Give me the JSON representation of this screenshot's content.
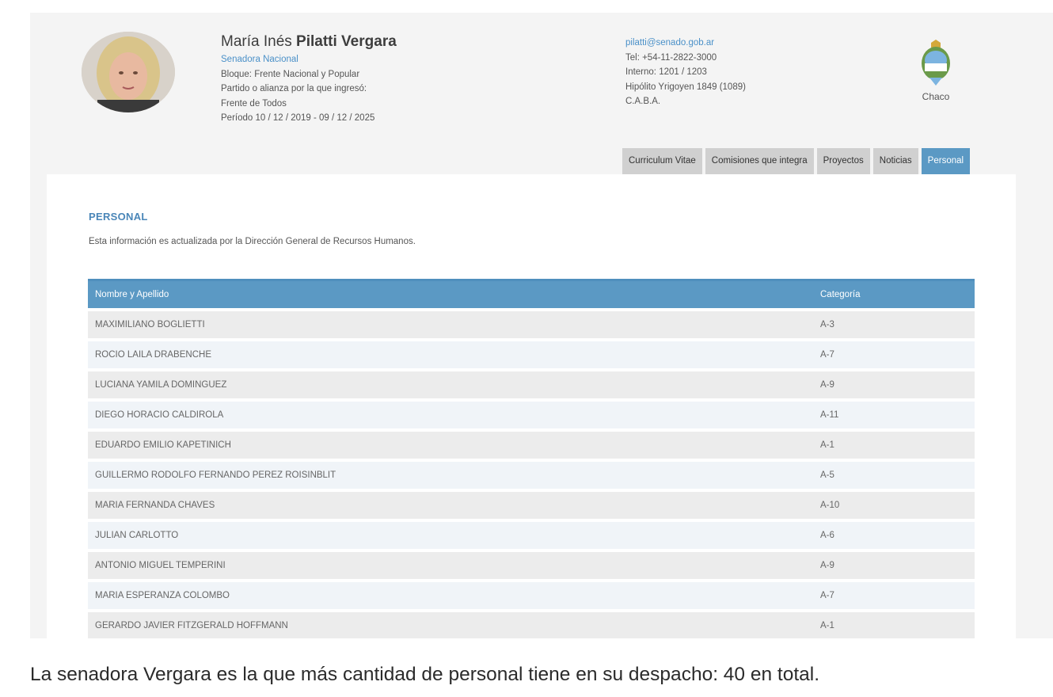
{
  "senator": {
    "name_first": "María Inés",
    "name_last": "Pilatti Vergara",
    "role": "Senadora Nacional",
    "bloc": "Bloque: Frente Nacional y Popular",
    "party_label": "Partido o alianza por la que ingresó:",
    "party": "Frente de Todos",
    "period": "Período 10 / 12 / 2019 - 09 / 12 / 2025",
    "photo_icon": "senator-portrait"
  },
  "contact": {
    "email": "pilatti@senado.gob.ar",
    "phone": "Tel: +54-11-2822-3000",
    "extension": "Interno: 1201 / 1203",
    "address": "Hipólito Yrigoyen 1849 (1089)",
    "city": "C.A.B.A."
  },
  "province": {
    "name": "Chaco",
    "icon": "province-coat-of-arms"
  },
  "tabs": [
    {
      "label": "Curriculum Vitae",
      "active": false
    },
    {
      "label": "Comisiones que integra",
      "active": false
    },
    {
      "label": "Proyectos",
      "active": false
    },
    {
      "label": "Noticias",
      "active": false
    },
    {
      "label": "Personal",
      "active": true
    }
  ],
  "section": {
    "title": "PERSONAL",
    "note": "Esta información es actualizada por la Dirección General de Recursos Humanos."
  },
  "table": {
    "headers": {
      "name": "Nombre y Apellido",
      "category": "Categoría"
    },
    "rows": [
      {
        "name": "MAXIMILIANO BOGLIETTI",
        "category": "A-3"
      },
      {
        "name": "ROCIO LAILA DRABENCHE",
        "category": "A-7"
      },
      {
        "name": "LUCIANA YAMILA DOMINGUEZ",
        "category": "A-9"
      },
      {
        "name": "DIEGO HORACIO CALDIROLA",
        "category": "A-11"
      },
      {
        "name": "EDUARDO EMILIO KAPETINICH",
        "category": "A-1"
      },
      {
        "name": "GUILLERMO RODOLFO FERNANDO PEREZ ROISINBLIT",
        "category": "A-5"
      },
      {
        "name": "MARIA FERNANDA CHAVES",
        "category": "A-10"
      },
      {
        "name": "JULIAN CARLOTTO",
        "category": "A-6"
      },
      {
        "name": "ANTONIO MIGUEL TEMPERINI",
        "category": "A-9"
      },
      {
        "name": "MARIA ESPERANZA COLOMBO",
        "category": "A-7"
      },
      {
        "name": "GERARDO JAVIER FITZGERALD HOFFMANN",
        "category": "A-1"
      }
    ]
  },
  "caption": "La senadora Vergara es la que más cantidad de personal tiene en su despacho: 40 en total.",
  "colors": {
    "accent": "#5b99c4",
    "link": "#4a90c8",
    "tab_inactive": "#d0d0d0"
  }
}
